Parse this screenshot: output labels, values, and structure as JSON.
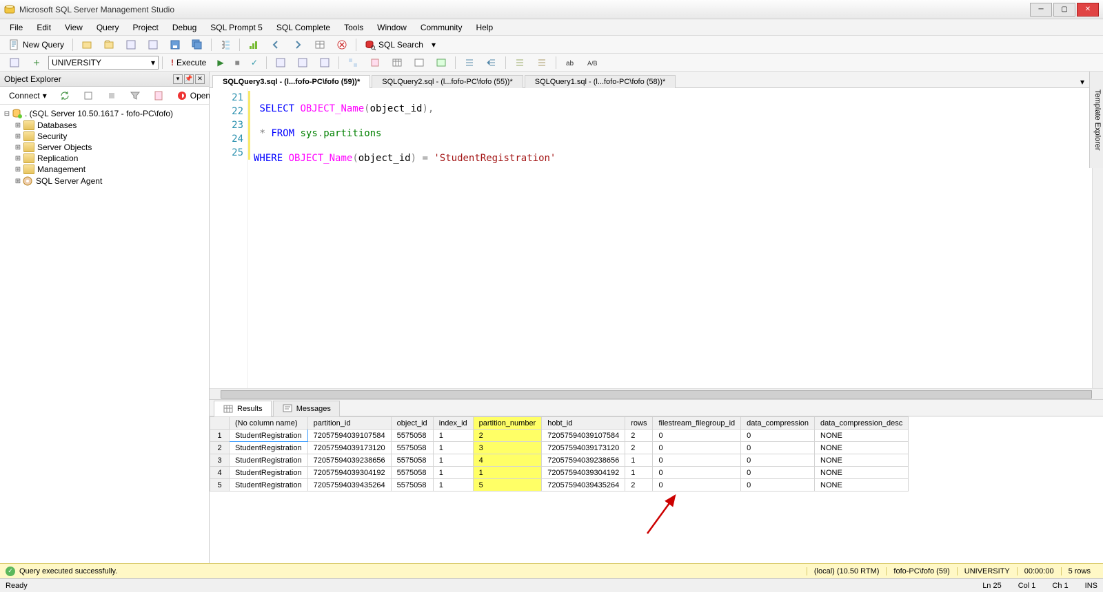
{
  "window": {
    "title": "Microsoft SQL Server Management Studio"
  },
  "menu": [
    "File",
    "Edit",
    "View",
    "Query",
    "Project",
    "Debug",
    "SQL Prompt 5",
    "SQL Complete",
    "Tools",
    "Window",
    "Community",
    "Help"
  ],
  "toolbar1": {
    "newQuery": "New Query",
    "sqlSearch": "SQL Search"
  },
  "toolbar2": {
    "database": "UNIVERSITY",
    "execute": "Execute"
  },
  "objectExplorer": {
    "title": "Object Explorer",
    "connect": "Connect",
    "open": "Open",
    "server": ". (SQL Server 10.50.1617 - fofo-PC\\fofo)",
    "nodes": [
      "Databases",
      "Security",
      "Server Objects",
      "Replication",
      "Management",
      "SQL Server Agent"
    ]
  },
  "tabs": [
    {
      "label": "SQLQuery3.sql - (l...fofo-PC\\fofo (59))*",
      "active": true
    },
    {
      "label": "SQLQuery2.sql - (l...fofo-PC\\fofo (55))*",
      "active": false
    },
    {
      "label": "SQLQuery1.sql - (l...fofo-PC\\fofo (58))*",
      "active": false
    }
  ],
  "code": {
    "lines": [
      21,
      22,
      23,
      24,
      25
    ],
    "l21_a": "SELECT",
    "l21_b": "OBJECT_Name",
    "l21_c": "object_id",
    "l22_a": "FROM",
    "l22_b": "sys",
    "l22_c": "partitions",
    "l23_a": "WHERE",
    "l23_b": "OBJECT_Name",
    "l23_c": "object_id",
    "l23_d": "'StudentRegistration'"
  },
  "resultsTabs": {
    "results": "Results",
    "messages": "Messages"
  },
  "grid": {
    "columns": [
      "",
      "(No column name)",
      "partition_id",
      "object_id",
      "index_id",
      "partition_number",
      "hobt_id",
      "rows",
      "filestream_filegroup_id",
      "data_compression",
      "data_compression_desc"
    ],
    "rows": [
      [
        "1",
        "StudentRegistration",
        "72057594039107584",
        "5575058",
        "1",
        "2",
        "72057594039107584",
        "2",
        "0",
        "0",
        "NONE"
      ],
      [
        "2",
        "StudentRegistration",
        "72057594039173120",
        "5575058",
        "1",
        "3",
        "72057594039173120",
        "2",
        "0",
        "0",
        "NONE"
      ],
      [
        "3",
        "StudentRegistration",
        "72057594039238656",
        "5575058",
        "1",
        "4",
        "72057594039238656",
        "1",
        "0",
        "0",
        "NONE"
      ],
      [
        "4",
        "StudentRegistration",
        "72057594039304192",
        "5575058",
        "1",
        "1",
        "72057594039304192",
        "1",
        "0",
        "0",
        "NONE"
      ],
      [
        "5",
        "StudentRegistration",
        "72057594039435264",
        "5575058",
        "1",
        "5",
        "72057594039435264",
        "2",
        "0",
        "0",
        "NONE"
      ]
    ]
  },
  "queryStatus": {
    "message": "Query executed successfully.",
    "server": "(local) (10.50 RTM)",
    "user": "fofo-PC\\fofo (59)",
    "db": "UNIVERSITY",
    "time": "00:00:00",
    "rows": "5 rows"
  },
  "statusbar": {
    "ready": "Ready",
    "ln": "Ln 25",
    "col": "Col 1",
    "ch": "Ch 1",
    "ins": "INS"
  },
  "sideTab": "Template Explorer"
}
